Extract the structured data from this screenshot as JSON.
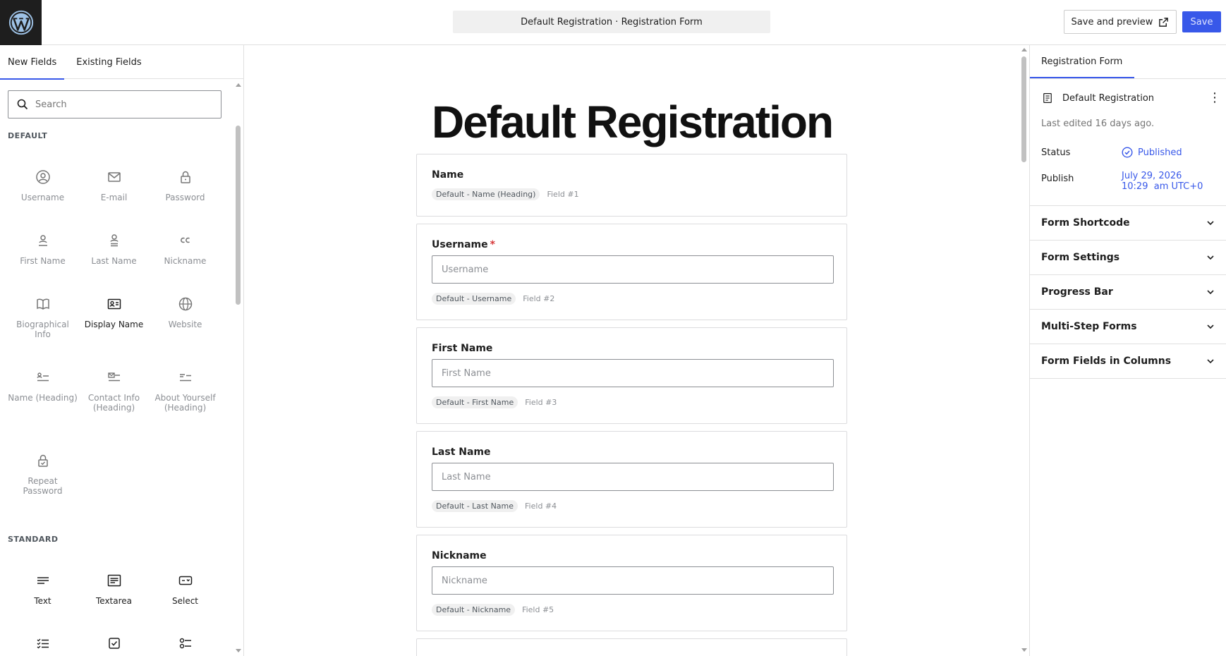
{
  "header": {
    "doc_title": "Default Registration · Registration Form",
    "save_preview_label": "Save and preview",
    "save_label": "Save"
  },
  "left_panel": {
    "tabs": [
      {
        "label": "New Fields"
      },
      {
        "label": "Existing Fields"
      }
    ],
    "search_placeholder": "Search",
    "default_section": "DEFAULT",
    "default_fields": [
      {
        "label": "Username",
        "icon": "user-circle-icon"
      },
      {
        "label": "E-mail",
        "icon": "envelope-icon"
      },
      {
        "label": "Password",
        "icon": "lock-icon"
      },
      {
        "label": "First Name",
        "icon": "person-icon"
      },
      {
        "label": "Last Name",
        "icon": "person-lines-icon"
      },
      {
        "label": "Nickname",
        "icon": "quote-icon"
      },
      {
        "label": "Biographical Info",
        "icon": "book-icon"
      },
      {
        "label": "Display Name",
        "icon": "id-card-icon"
      },
      {
        "label": "Website",
        "icon": "globe-icon"
      },
      {
        "label": "Name (Heading)",
        "icon": "person-heading-icon"
      },
      {
        "label": "Contact Info (Heading)",
        "icon": "envelope-heading-icon"
      },
      {
        "label": "About Yourself (Heading)",
        "icon": "lines-heading-icon"
      },
      {
        "label": "Repeat Password",
        "icon": "lock-check-icon"
      }
    ],
    "standard_section": "STANDARD",
    "standard_fields": [
      {
        "label": "Text",
        "icon": "text-lines-icon"
      },
      {
        "label": "Textarea",
        "icon": "textarea-icon"
      },
      {
        "label": "Select",
        "icon": "select-icon"
      }
    ]
  },
  "canvas": {
    "page_title": "Default Registration",
    "fields": [
      {
        "label": "Name",
        "required": false,
        "placeholder": "",
        "tag": "Default - Name (Heading)",
        "field_no": "Field #1"
      },
      {
        "label": "Username",
        "required": true,
        "placeholder": "Username",
        "tag": "Default - Username",
        "field_no": "Field #2"
      },
      {
        "label": "First Name",
        "required": false,
        "placeholder": "First Name",
        "tag": "Default - First Name",
        "field_no": "Field #3"
      },
      {
        "label": "Last Name",
        "required": false,
        "placeholder": "Last Name",
        "tag": "Default - Last Name",
        "field_no": "Field #4"
      },
      {
        "label": "Nickname",
        "required": false,
        "placeholder": "Nickname",
        "tag": "Default - Nickname",
        "field_no": "Field #5"
      }
    ],
    "required_mark": "*"
  },
  "right_panel": {
    "tab_label": "Registration Form",
    "doc_name": "Default Registration",
    "last_edited": "Last edited 16 days ago.",
    "status_label": "Status",
    "status_value": "Published",
    "publish_label": "Publish",
    "publish_date": "July 29, 2026",
    "publish_time": "10:29  am UTC+0",
    "sections": [
      {
        "label": "Form Shortcode"
      },
      {
        "label": "Form Settings"
      },
      {
        "label": "Progress Bar"
      },
      {
        "label": "Multi-Step Forms"
      },
      {
        "label": "Form Fields in Columns"
      }
    ]
  },
  "colors": {
    "accent": "#3858e9",
    "required": "#d63638"
  }
}
